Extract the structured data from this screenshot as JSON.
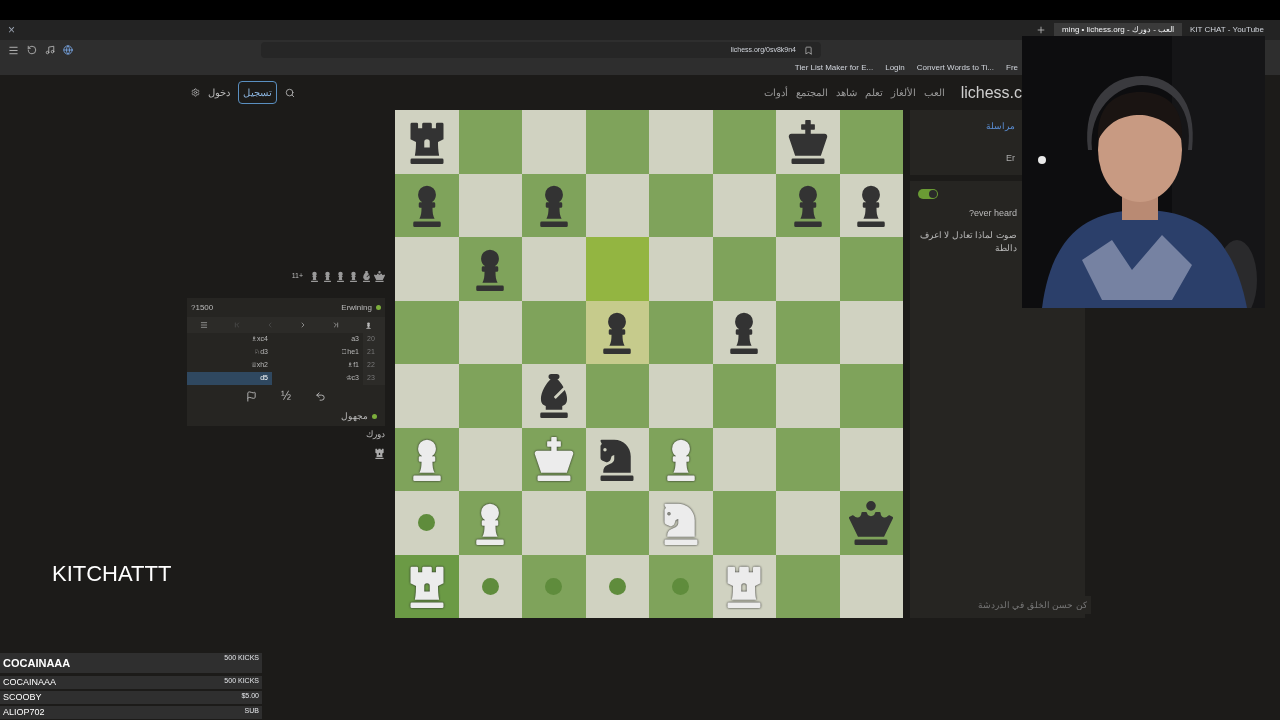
{
  "browser": {
    "window_close": "×",
    "tabs": [
      {
        "title": "KIT CHAT - YouTube",
        "selected": false
      },
      {
        "title": "ming • lichess.org - العب - دورك",
        "selected": true
      }
    ],
    "url": "lichess.org/0sv8k9n4",
    "bookmarks": [
      "Fre",
      "Convert Words to Ti...",
      "Login",
      "Tier List Maker for E..."
    ]
  },
  "site": {
    "logo": "lichess.c",
    "nav": [
      "العب",
      "الألغاز",
      "تعلم",
      "شاهد",
      "المجتمع",
      "أدوات"
    ],
    "signup": "تسجيل",
    "login": "دخول"
  },
  "material": {
    "advantage": "11+",
    "pieces": [
      {
        "kind": "pawn"
      },
      {
        "kind": "pawn"
      },
      {
        "kind": "pawn"
      },
      {
        "kind": "pawn"
      },
      {
        "kind": "bishop"
      },
      {
        "kind": "queen"
      }
    ]
  },
  "opponent": {
    "rating": "?1500",
    "name": "Erwining",
    "online": true
  },
  "moves": [
    {
      "number": "20",
      "white": {
        "san": "a3",
        "selected": false
      },
      "black": {
        "san": "♗xc4",
        "selected": false
      }
    },
    {
      "number": "21",
      "white": {
        "san": "♖he1",
        "selected": false
      },
      "black": {
        "san": "♘d3",
        "selected": false
      }
    },
    {
      "number": "22",
      "white": {
        "san": "♗f1",
        "selected": false
      },
      "black": {
        "san": "♕xh2",
        "selected": false
      }
    },
    {
      "number": "23",
      "white": {
        "san": "♔c3",
        "selected": false
      },
      "black": {
        "san": "d5",
        "selected": true
      }
    }
  ],
  "draw_offer": "½",
  "player": {
    "name": "مجهول",
    "online": true
  },
  "turn": "دورك",
  "board": {
    "ranks": [
      [
        {
          "kind": "black_rook"
        },
        {
          "kind": "empty"
        },
        {
          "kind": "empty"
        },
        {
          "kind": "empty"
        },
        {
          "kind": "empty"
        },
        {
          "kind": "empty"
        },
        {
          "kind": "black_king"
        },
        {
          "kind": "empty"
        }
      ],
      [
        {
          "kind": "black_pawn"
        },
        {
          "kind": "empty"
        },
        {
          "kind": "black_pawn"
        },
        {
          "kind": "empty"
        },
        {
          "kind": "empty"
        },
        {
          "kind": "empty"
        },
        {
          "kind": "black_pawn"
        },
        {
          "kind": "black_pawn"
        }
      ],
      [
        {
          "kind": "empty"
        },
        {
          "kind": "black_pawn"
        },
        {
          "kind": "empty"
        },
        {
          "kind": "empty",
          "last_move": true
        },
        {
          "kind": "empty"
        },
        {
          "kind": "empty"
        },
        {
          "kind": "empty"
        },
        {
          "kind": "empty"
        }
      ],
      [
        {
          "kind": "empty"
        },
        {
          "kind": "empty"
        },
        {
          "kind": "empty"
        },
        {
          "kind": "black_pawn",
          "last_move": true
        },
        {
          "kind": "empty"
        },
        {
          "kind": "black_pawn"
        },
        {
          "kind": "empty"
        },
        {
          "kind": "empty"
        }
      ],
      [
        {
          "kind": "empty"
        },
        {
          "kind": "empty"
        },
        {
          "kind": "black_bishop"
        },
        {
          "kind": "empty"
        },
        {
          "kind": "empty"
        },
        {
          "kind": "empty"
        },
        {
          "kind": "empty"
        },
        {
          "kind": "empty"
        }
      ],
      [
        {
          "kind": "white_pawn"
        },
        {
          "kind": "empty"
        },
        {
          "kind": "white_king"
        },
        {
          "kind": "black_knight"
        },
        {
          "kind": "white_pawn"
        },
        {
          "kind": "empty"
        },
        {
          "kind": "empty"
        },
        {
          "kind": "empty"
        }
      ],
      [
        {
          "kind": "move_dot"
        },
        {
          "kind": "white_pawn"
        },
        {
          "kind": "empty"
        },
        {
          "kind": "empty"
        },
        {
          "kind": "white_knight"
        },
        {
          "kind": "empty"
        },
        {
          "kind": "empty"
        },
        {
          "kind": "black_queen"
        }
      ],
      [
        {
          "kind": "white_rook",
          "selected": true
        },
        {
          "kind": "move_dot"
        },
        {
          "kind": "move_dot"
        },
        {
          "kind": "move_dot"
        },
        {
          "kind": "move_dot"
        },
        {
          "kind": "white_rook"
        },
        {
          "kind": "empty"
        },
        {
          "kind": "empty"
        }
      ]
    ]
  },
  "chat": {
    "header": [
      {
        "text": "مراسلة",
        "kind": "link"
      },
      {
        "text": "Er",
        "kind": "plain"
      }
    ],
    "toggle_on": true,
    "messages": [
      "?ever heard",
      "صوت لماذا تعادل لا اعرف دالطة"
    ],
    "placeholder": "كن حسن الخلق في الدردشة"
  },
  "overlay": {
    "title": "KITCHATTT",
    "donations": [
      {
        "name": "COCAINAAA",
        "amount": "500 KICKS",
        "latest": true
      },
      {
        "name": "COCAINAAA",
        "amount": "500 KICKS",
        "latest": false
      },
      {
        "name": "SCOOBY",
        "amount": "$5.00",
        "latest": false
      },
      {
        "name": "ALIOP702",
        "amount": "SUB",
        "latest": false
      }
    ]
  }
}
